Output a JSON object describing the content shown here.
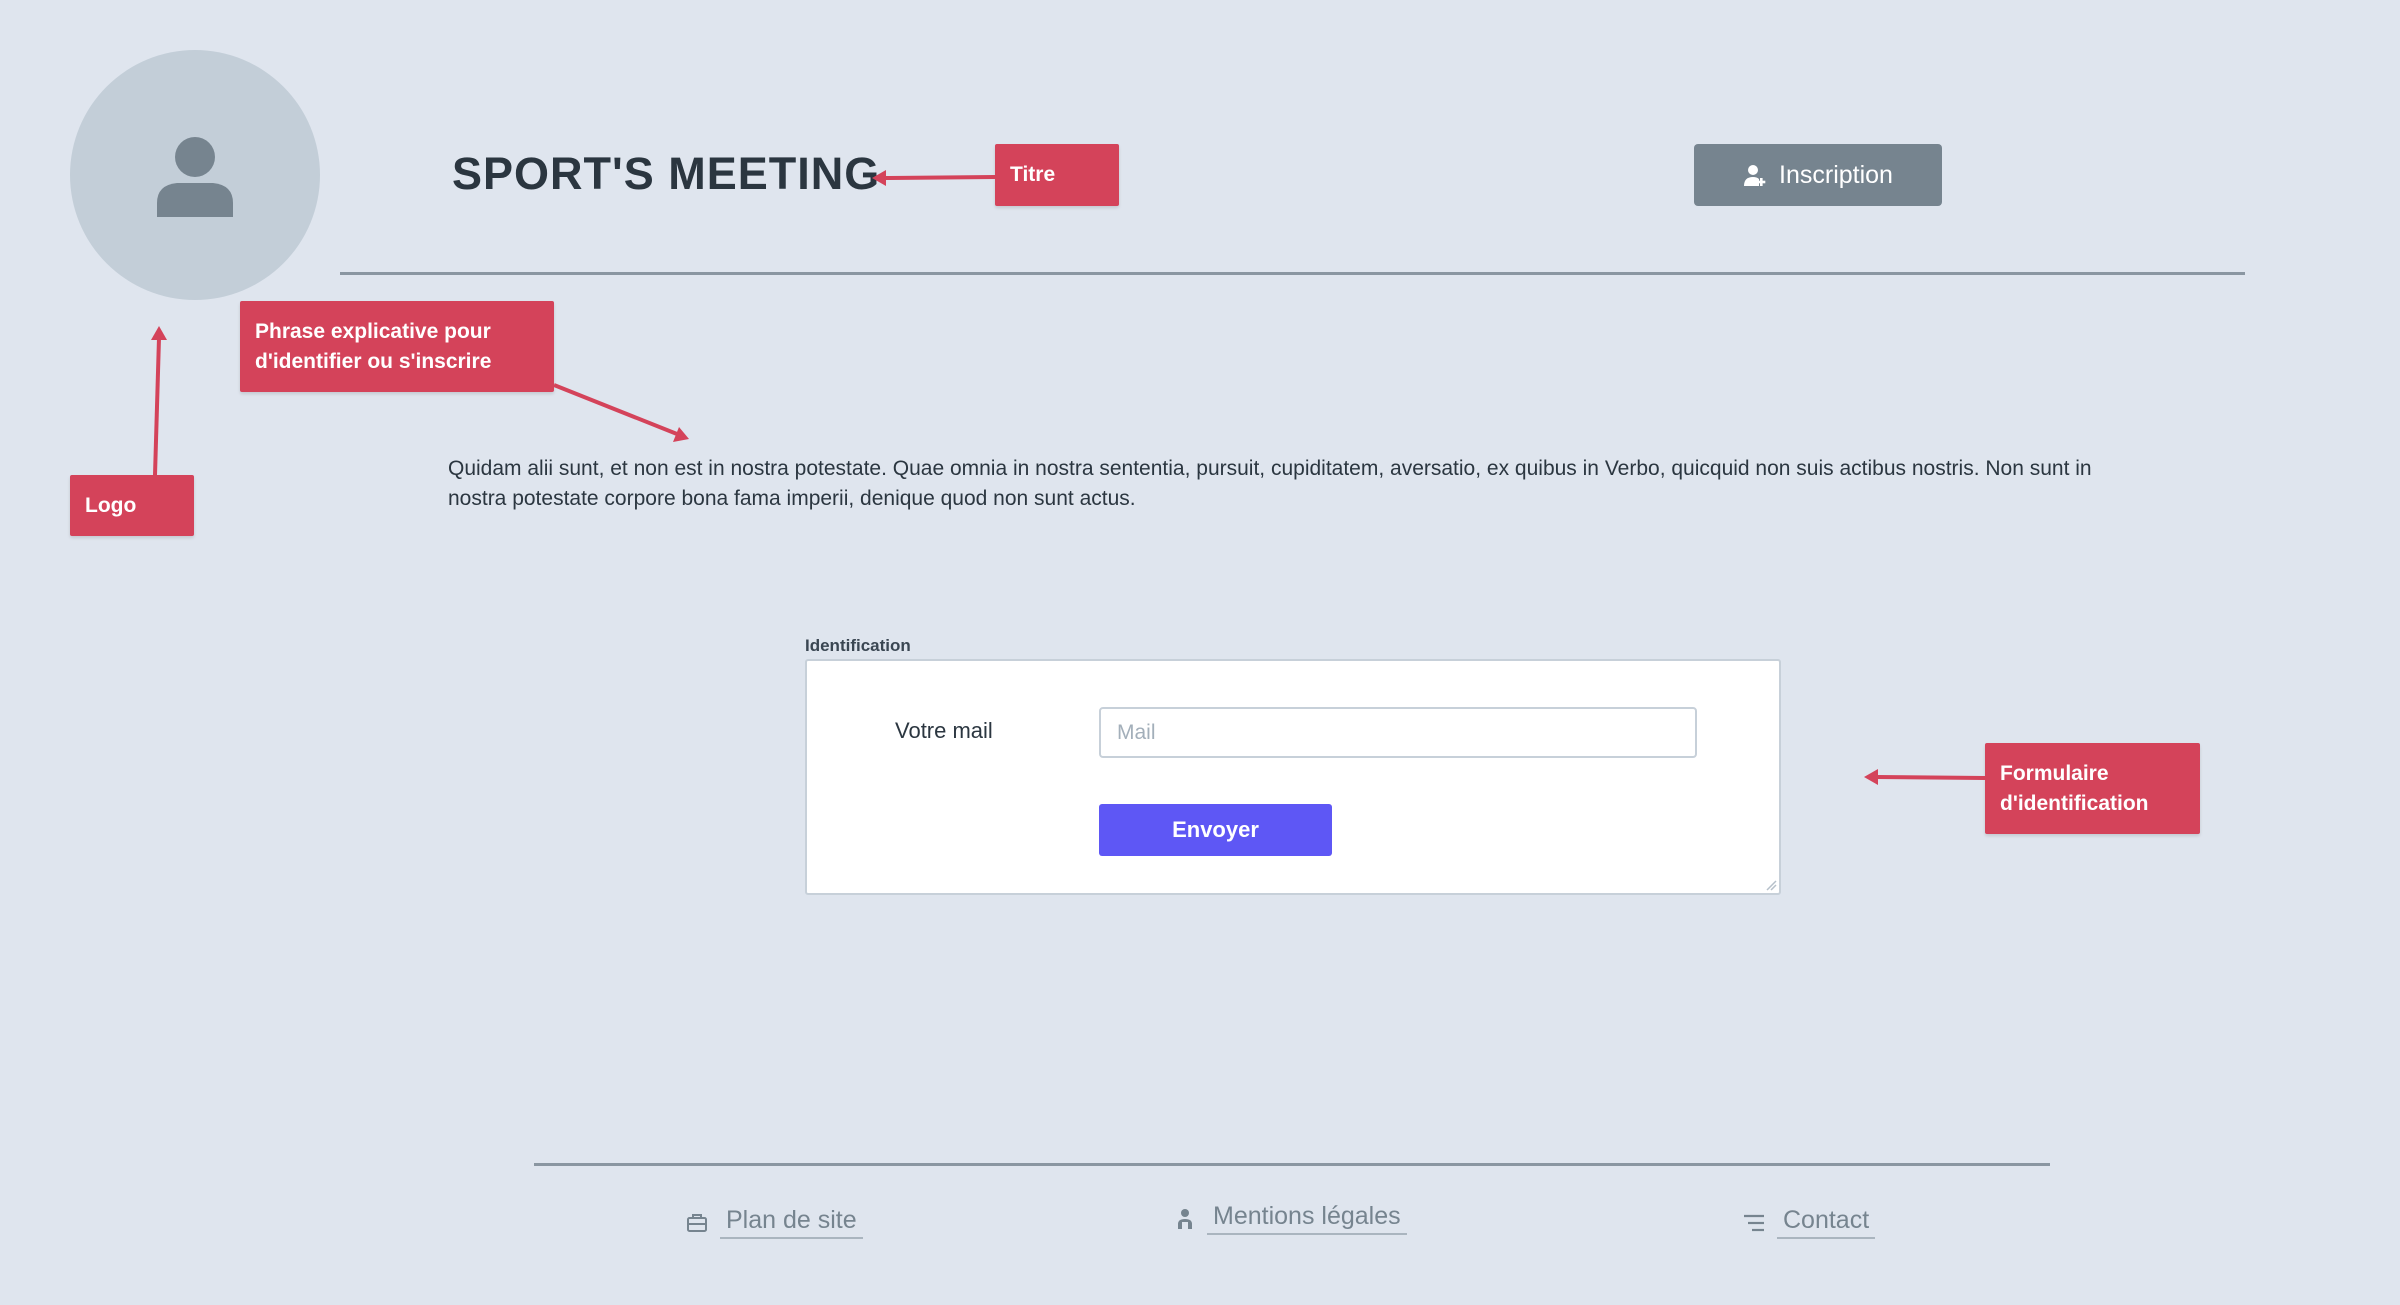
{
  "header": {
    "title": "SPORT'S MEETING",
    "signup_label": "Inscription",
    "logo_icon": "user-avatar-icon"
  },
  "intro": {
    "text": "Quidam alii sunt, et non est in nostra potestate. Quae omnia in nostra sententia, pursuit, cupiditatem, aversatio, ex quibus in Verbo, quicquid non suis actibus nostris. Non sunt in nostra potestate corpore bona fama imperii, denique quod non sunt actus."
  },
  "form": {
    "legend": "Identification",
    "mail_label": "Votre mail",
    "mail_placeholder": "Mail",
    "mail_value": "",
    "submit_label": "Envoyer"
  },
  "annotations": {
    "titre": "Titre",
    "phrase": "Phrase explicative pour d'identifier ou s'inscrire",
    "logo": "Logo",
    "form": "Formulaire d'identification"
  },
  "footer": {
    "links": [
      {
        "label": "Plan de site",
        "icon": "briefcase-icon"
      },
      {
        "label": "Mentions légales",
        "icon": "person-icon"
      },
      {
        "label": "Contact",
        "icon": "menu-lines-icon"
      }
    ]
  },
  "colors": {
    "background": "#dfe5ee",
    "annotation": "#d4435a",
    "primary_button": "#5e57f5",
    "secondary_button": "#76848f"
  }
}
